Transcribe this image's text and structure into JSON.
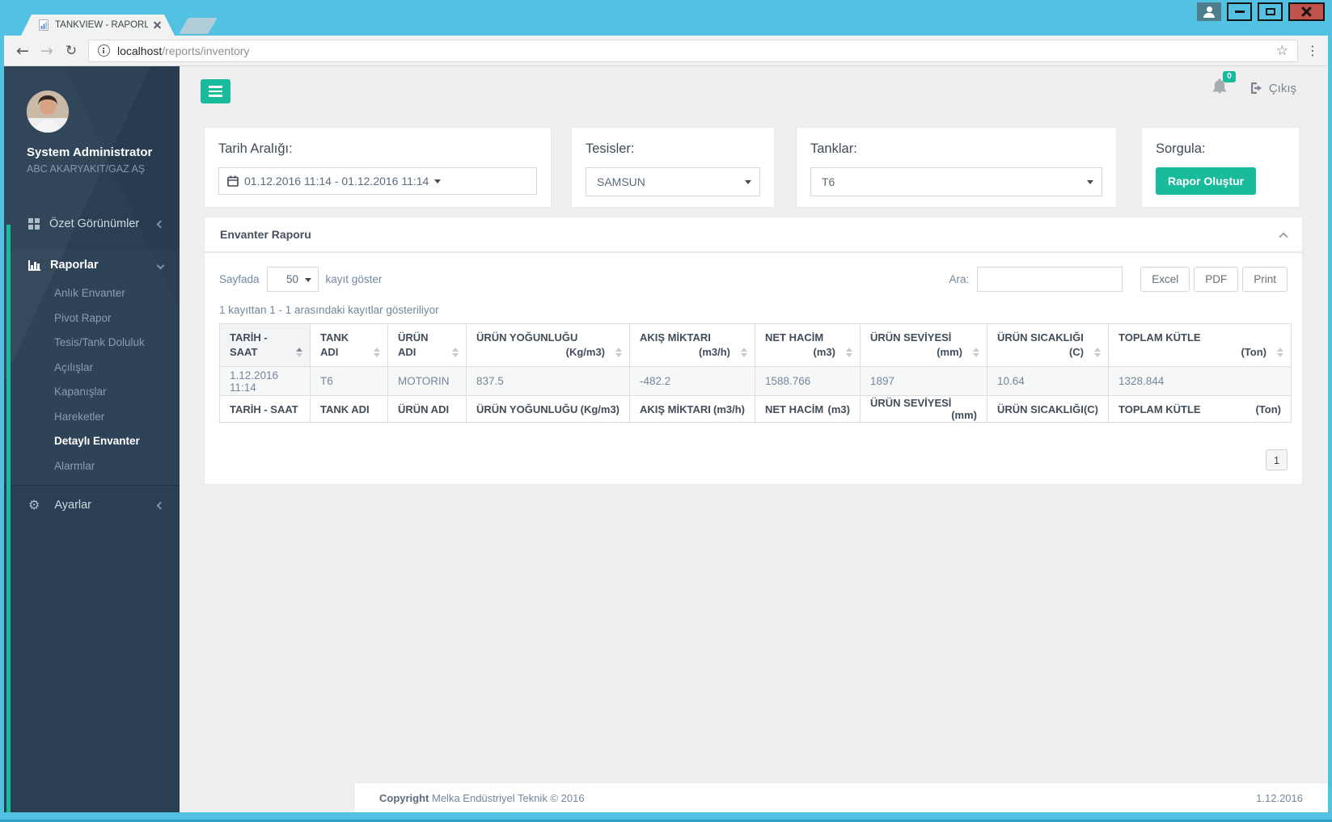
{
  "window": {
    "tab_title": "TANKVIEW - RAPORLAR",
    "url_host": "localhost",
    "url_path": "/reports/inventory"
  },
  "icons": {
    "back": "←",
    "forward": "→",
    "reload": "↻",
    "more": "⋮",
    "star": "☆",
    "gear": "⚙"
  },
  "topbar": {
    "notification_count": "0",
    "logout_label": "Çıkış"
  },
  "sidebar": {
    "user_name": "System Administrator",
    "user_org": "ABC AKARYAKIT/GAZ AŞ",
    "overview_label": "Özet Görünümler",
    "reports_label": "Raporlar",
    "settings_label": "Ayarlar",
    "reports_children": [
      "Anlık Envanter",
      "Pivot Rapor",
      "Tesis/Tank Doluluk",
      "Açılışlar",
      "Kapanışlar",
      "Hareketler",
      "Detaylı Envanter",
      "Alarmlar"
    ],
    "active_child": "Detaylı Envanter"
  },
  "filters": {
    "date_label": "Tarih Aralığı:",
    "date_value": "01.12.2016 11:14 - 01.12.2016 11:14",
    "facility_label": "Tesisler:",
    "facility_value": "SAMSUN",
    "tank_label": "Tanklar:",
    "tank_value": "T6",
    "query_label": "Sorgula:",
    "query_button": "Rapor Oluştur"
  },
  "report": {
    "panel_title": "Envanter Raporu",
    "page_size_prefix": "Sayfada",
    "page_size_value": "50",
    "page_size_suffix": "kayıt göster",
    "search_label": "Ara:",
    "export_buttons": [
      "Excel",
      "PDF",
      "Print"
    ],
    "info_text": "1 kayıttan 1 - 1 arasındaki kayıtlar gösteriliyor",
    "pagination": [
      "1"
    ]
  },
  "table": {
    "columns": [
      {
        "label": "TARİH - SAAT",
        "unit": ""
      },
      {
        "label": "TANK ADI",
        "unit": ""
      },
      {
        "label": "ÜRÜN ADI",
        "unit": ""
      },
      {
        "label": "ÜRÜN YOĞUNLUĞU",
        "unit": "(Kg/m3)"
      },
      {
        "label": "AKIŞ MİKTARI",
        "unit": "(m3/h)"
      },
      {
        "label": "NET HACİM",
        "unit": "(m3)"
      },
      {
        "label": "ÜRÜN SEVİYESİ",
        "unit": "(mm)"
      },
      {
        "label": "ÜRÜN SICAKLIĞI",
        "unit": "(C)"
      },
      {
        "label": "TOPLAM KÜTLE",
        "unit": "(Ton)"
      }
    ],
    "rows": [
      [
        "1.12.2016 11:14",
        "T6",
        "MOTORIN",
        "837.5",
        "-482.2",
        "1588.766",
        "1897",
        "10.64",
        "1328.844"
      ]
    ]
  },
  "footer": {
    "copyright_label": "Copyright",
    "copyright_text": " Melka Endüstriyel Teknik © 2016",
    "date": "1.12.2016"
  }
}
